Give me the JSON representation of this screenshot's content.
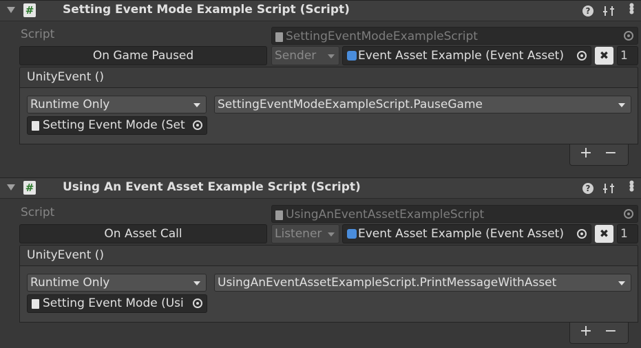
{
  "components": [
    {
      "title": "Setting Event Mode Example Script (Script)",
      "script_label": "Script",
      "script_value": "SettingEventModeExampleScript",
      "event_name": "On Game Paused",
      "mode": "Sender",
      "asset": "Event Asset Example (Event Asset)",
      "remove_label": "✖",
      "count": "1",
      "unity_event_header": "UnityEvent ()",
      "call_state": "Runtime Only",
      "function": "SettingEventModeExampleScript.PauseGame",
      "target": "Setting Event Mode (Set",
      "add_label": "+",
      "remove_listener_label": "−"
    },
    {
      "title": "Using An Event Asset Example Script (Script)",
      "script_label": "Script",
      "script_value": "UsingAnEventAssetExampleScript",
      "event_name": "On Asset Call",
      "mode": "Listener",
      "asset": "Event Asset Example (Event Asset)",
      "remove_label": "✖",
      "count": "1",
      "unity_event_header": "UnityEvent ()",
      "call_state": "Runtime Only",
      "function": "UsingAnEventAssetExampleScript.PrintMessageWithAsset",
      "target": "Setting Event Mode (Usi",
      "add_label": "+",
      "remove_listener_label": "−"
    }
  ],
  "icons": {
    "script": "#",
    "help": "?",
    "kebab": "⋮"
  }
}
